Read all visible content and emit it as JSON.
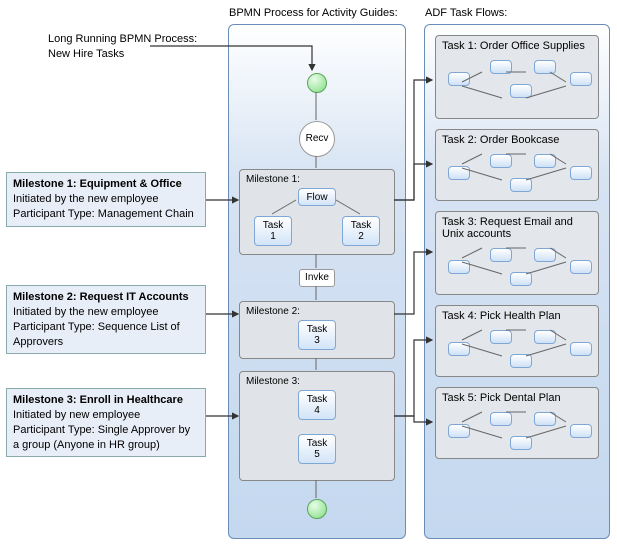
{
  "header": {
    "longRunningLabel": "Long Running BPMN Process:\nNew Hire Tasks"
  },
  "bpmnPanel": {
    "title": "BPMN Process for Activity Guides:",
    "recvLabel": "Recv",
    "invokeLabel": "Invke",
    "milestone1Label": "Milestone 1:",
    "milestone2Label": "Milestone 2:",
    "milestone3Label": "Milestone 3:",
    "flowLabel": "Flow",
    "task1": "Task\n1",
    "task2": "Task\n2",
    "task3": "Task\n3",
    "task4": "Task\n4",
    "task5": "Task\n5"
  },
  "adfPanel": {
    "title": "ADF Task Flows:",
    "tasks": [
      {
        "label": "Task 1: Order Office Supplies"
      },
      {
        "label": "Task 2: Order Bookcase"
      },
      {
        "label": "Task 3: Request Email and Unix accounts"
      },
      {
        "label": "Task 4: Pick Health Plan"
      },
      {
        "label": "Task 5: Pick Dental Plan"
      }
    ]
  },
  "annotations": {
    "m1": {
      "title": "Milestone 1: Equipment & Office",
      "line2": "Initiated by the new employee",
      "line3": "Participant Type: Management Chain"
    },
    "m2": {
      "title": "Milestone 2: Request IT Accounts",
      "line2": "Initiated by the new employee",
      "line3": "Participant Type: Sequence List of Approvers"
    },
    "m3": {
      "title": "Milestone 3: Enroll in Healthcare",
      "line2": "Initiated by new employee",
      "line3": "Participant Type: Single Approver by a group (Anyone in HR group)"
    }
  }
}
